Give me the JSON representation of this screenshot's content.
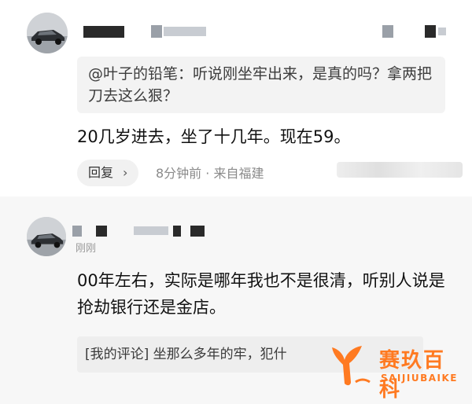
{
  "comment_top": {
    "quote": "@叶子的铅笔：听说刚坐牢出来，是真的吗？拿两把刀去这么狠？",
    "text": "20几岁进去，坐了十几年。现在59。",
    "reply_label": "回复",
    "reply_chevron": "›",
    "meta": "8分钟前 · 来自福建"
  },
  "comment_second": {
    "name": "刚刚",
    "text": "00年左右，实际是哪年我也不是很清，听别人说是抢劫银行还是金店。",
    "quote": "[我的评论] 坐那么多年的牢，犯什"
  },
  "watermark": {
    "cn": "赛玖百科",
    "en": "SAIJIUBAIKE",
    "color": "#ff7a21"
  },
  "icons": [
    "avatar-car-icon",
    "chevron-right-icon",
    "whale-tail-logo-icon"
  ]
}
